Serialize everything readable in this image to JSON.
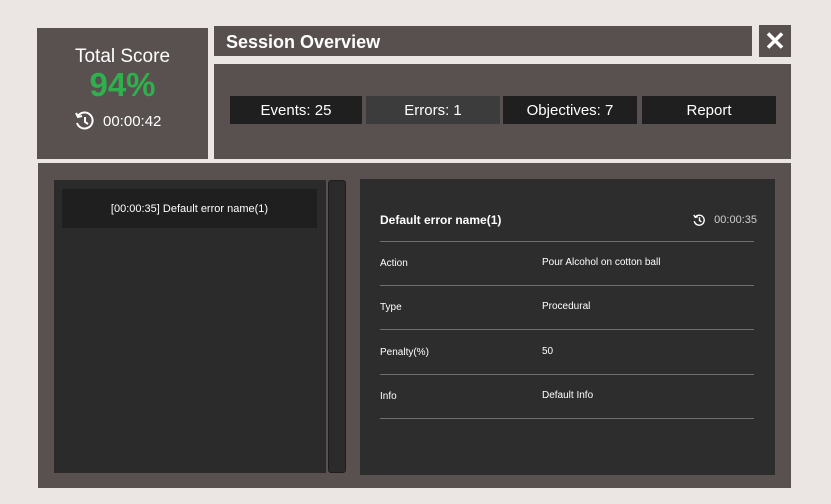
{
  "score": {
    "title": "Total Score",
    "value": "94%",
    "time": "00:00:42"
  },
  "header": {
    "title": "Session Overview",
    "close_label": "✕"
  },
  "stats": {
    "events": "Events: 25",
    "errors": "Errors: 1",
    "objectives": "Objectives: 7",
    "report": "Report"
  },
  "event_list": {
    "items": [
      {
        "label": "[00:00:35] Default error name(1)"
      }
    ]
  },
  "detail": {
    "title": "Default error name(1)",
    "time": "00:00:35",
    "rows": [
      {
        "label": "Action",
        "value": "Pour Alcohol on cotton ball"
      },
      {
        "label": "Type",
        "value": "Procedural"
      },
      {
        "label": "Penalty(%)",
        "value": "50"
      },
      {
        "label": "Info",
        "value": "Default Info"
      }
    ]
  },
  "colors": {
    "accent_green": "#2fb04d",
    "panel": "#58514f",
    "dark_panel": "#2d2d2d"
  }
}
